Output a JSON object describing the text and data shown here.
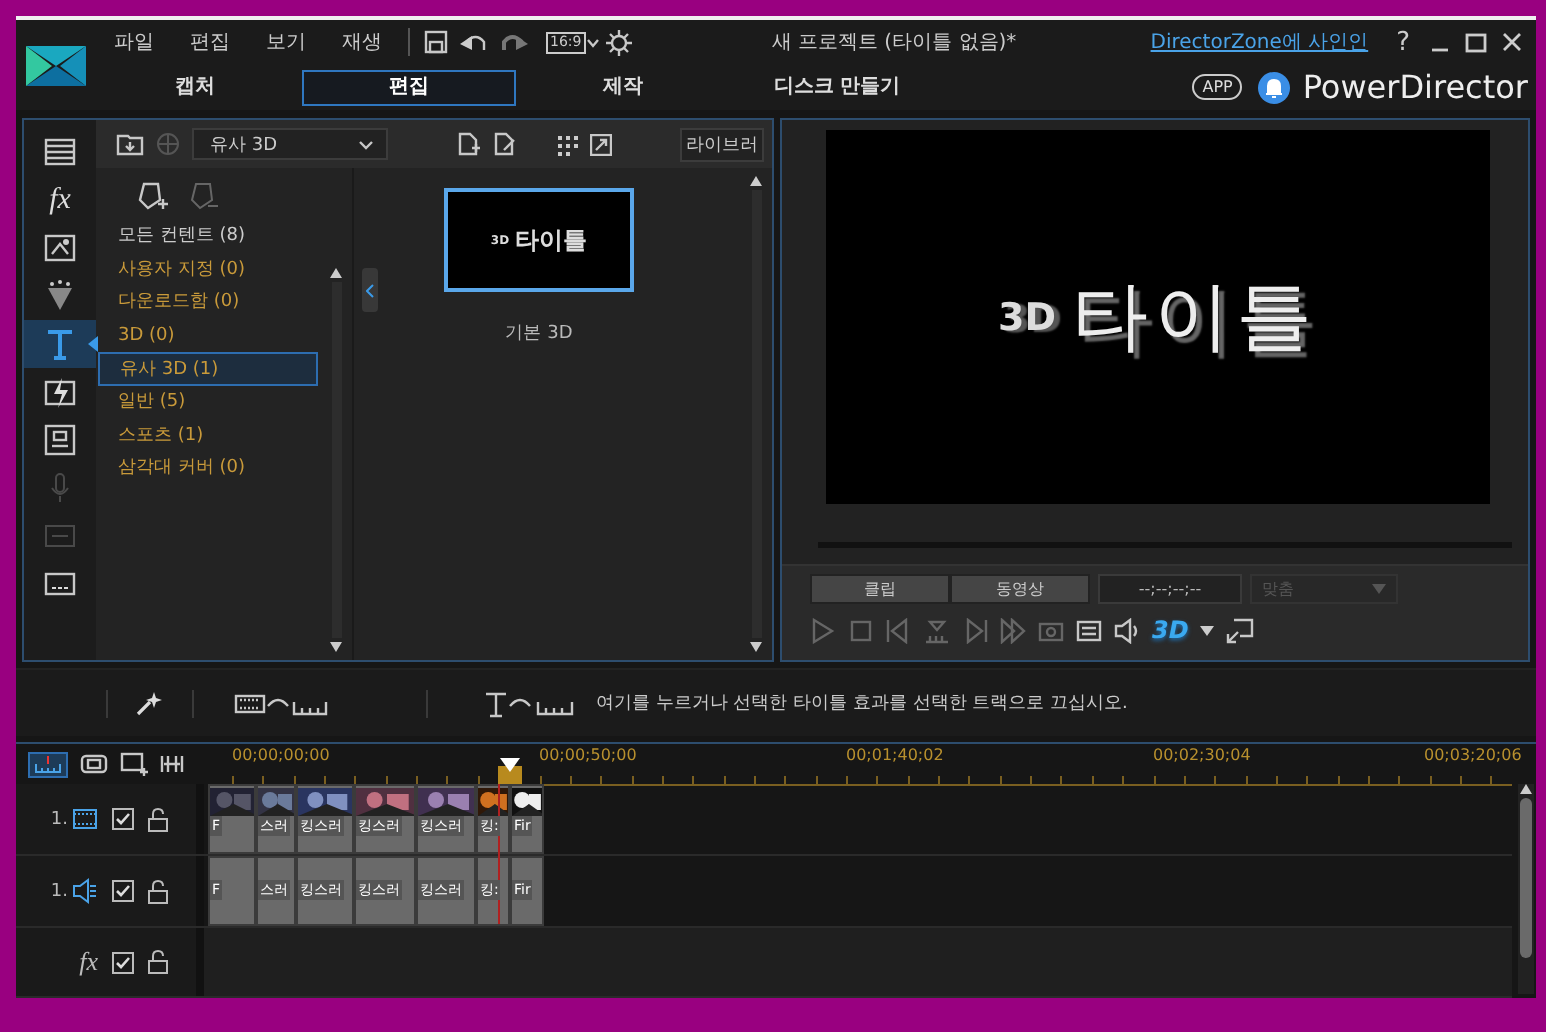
{
  "window": {
    "menu": [
      "파일",
      "편집",
      "보기",
      "재생"
    ],
    "aspect": "16:9",
    "title": "새 프로젝트 (타이틀 없음)*",
    "sign_in_link": "DirectorZone에 사인인",
    "help": "?"
  },
  "tabs": [
    {
      "label": "캡처",
      "selected": false
    },
    {
      "label": "편집",
      "selected": true
    },
    {
      "label": "제작",
      "selected": false
    },
    {
      "label": "디스크 만들기",
      "selected": false
    }
  ],
  "brand": {
    "app_badge": "APP",
    "name": "PowerDirector"
  },
  "rail": [
    {
      "kind": "media",
      "selected": false,
      "disabled": false
    },
    {
      "kind": "effect",
      "label": "fx",
      "selected": false,
      "disabled": false
    },
    {
      "kind": "pip",
      "selected": false,
      "disabled": false
    },
    {
      "kind": "particle",
      "selected": false,
      "disabled": false
    },
    {
      "kind": "title",
      "selected": true,
      "disabled": false
    },
    {
      "kind": "transition",
      "selected": false,
      "disabled": false
    },
    {
      "kind": "menu",
      "selected": false,
      "disabled": false
    },
    {
      "kind": "voice",
      "selected": false,
      "disabled": true
    },
    {
      "kind": "chapter",
      "selected": false,
      "disabled": true
    },
    {
      "kind": "subtitle",
      "selected": false,
      "disabled": false
    }
  ],
  "library": {
    "dropdown": "유사 3D",
    "library_button": "라이브러",
    "categories": [
      {
        "label": "모든 컨텐트 (8)",
        "kind": "all",
        "selected": false
      },
      {
        "label": "사용자 지정  (0)",
        "kind": "tag",
        "selected": false
      },
      {
        "label": "다운로드함  (0)",
        "kind": "tag",
        "selected": false
      },
      {
        "label": "3D  (0)",
        "kind": "tag",
        "selected": false
      },
      {
        "label": "유사 3D  (1)",
        "kind": "tag",
        "selected": true
      },
      {
        "label": "일반  (5)",
        "kind": "tag",
        "selected": false
      },
      {
        "label": "스포츠  (1)",
        "kind": "tag",
        "selected": false
      },
      {
        "label": "삼각대 커버  (0)",
        "kind": "tag",
        "selected": false
      }
    ],
    "templates": [
      {
        "label": "기본 3D",
        "badge": "3D",
        "title": "타이틀",
        "selected": true
      }
    ]
  },
  "preview": {
    "badge": "3D",
    "title": "타이틀",
    "modes": [
      {
        "label": "클립",
        "selected": false
      },
      {
        "label": "동영상",
        "selected": false
      }
    ],
    "timecode": "--;--;--;--",
    "zoom": "맞춤",
    "zoom_disabled": true,
    "stereo": "3D"
  },
  "tools": {
    "hint": "여기를 누르거나 선택한 타이틀 효과를 선택한 트랙으로 끄십시오."
  },
  "timeline": {
    "ruler": [
      "00;00;00;00",
      "00;00;50;00",
      "00;01;40;02",
      "00;02;30;04",
      "00;03;20;06"
    ],
    "tracks": [
      {
        "kind": "video",
        "number": "1.",
        "checked": true
      },
      {
        "kind": "audio",
        "number": "1.",
        "checked": true
      },
      {
        "kind": "effect",
        "label": "fx",
        "checked": true
      }
    ],
    "clips": [
      {
        "video_label": "F",
        "audio_label": "F"
      },
      {
        "video_label": "스러",
        "audio_label": "스러"
      },
      {
        "video_label": "킹스러",
        "audio_label": "킹스러"
      },
      {
        "video_label": "킹스러",
        "audio_label": "킹스러"
      },
      {
        "video_label": "킹스러",
        "audio_label": "킹스러"
      },
      {
        "video_label": "킹:",
        "audio_label": "킹:"
      },
      {
        "video_label": "Fir",
        "audio_label": "Fir"
      }
    ]
  }
}
